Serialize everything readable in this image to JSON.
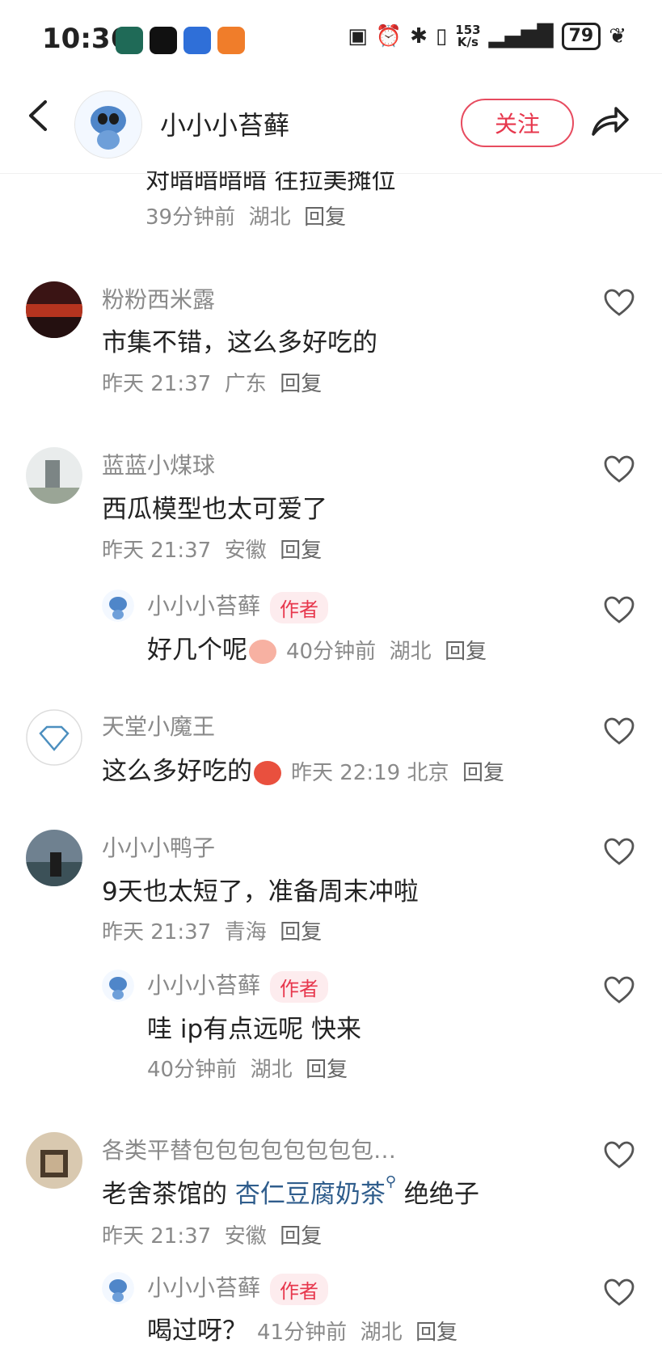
{
  "status_bar": {
    "time": "10:36",
    "speed_value": "153",
    "speed_unit": "K/s",
    "battery": "79"
  },
  "header": {
    "title": "小小小苔藓",
    "follow_label": "关注"
  },
  "top_partial": {
    "text": "对暗暗暗暗 往拉美摊位",
    "time": "39分钟前",
    "location": "湖北",
    "reply": "回复"
  },
  "comments": [
    {
      "user": "粉粉西米露",
      "text": "市集不错，这么多好吃的",
      "time": "昨天 21:37",
      "location": "广东",
      "reply": "回复"
    },
    {
      "user": "蓝蓝小煤球",
      "text": "西瓜模型也太可爱了",
      "time": "昨天 21:37",
      "location": "安徽",
      "reply": "回复"
    },
    {
      "user": "小小小苔藓",
      "author_tag": "作者",
      "text": "好几个呢",
      "time": "40分钟前",
      "location": "湖北",
      "reply": "回复"
    },
    {
      "user": "天堂小魔王",
      "text": "这么多好吃的",
      "time": "昨天 22:19",
      "location": "北京",
      "reply": "回复"
    },
    {
      "user": "小小小鸭子",
      "text": "9天也太短了，准备周末冲啦",
      "time": "昨天 21:37",
      "location": "青海",
      "reply": "回复"
    },
    {
      "user": "小小小苔藓",
      "author_tag": "作者",
      "text": "哇 ip有点远呢 快来",
      "time": "40分钟前",
      "location": "湖北",
      "reply": "回复"
    },
    {
      "user": "各类平替包包包包包包包包…",
      "text_a": "老舍茶馆的",
      "link": "杏仁豆腐奶茶",
      "text_b": "绝绝子",
      "time": "昨天 21:37",
      "location": "安徽",
      "reply": "回复"
    },
    {
      "user": "小小小苔藓",
      "author_tag": "作者",
      "text": "喝过呀？",
      "time": "41分钟前",
      "location": "湖北",
      "reply": "回复"
    }
  ],
  "colors": {
    "accent": "#e7374d",
    "muted": "#8a8a8a",
    "link": "#2f5d8c"
  }
}
